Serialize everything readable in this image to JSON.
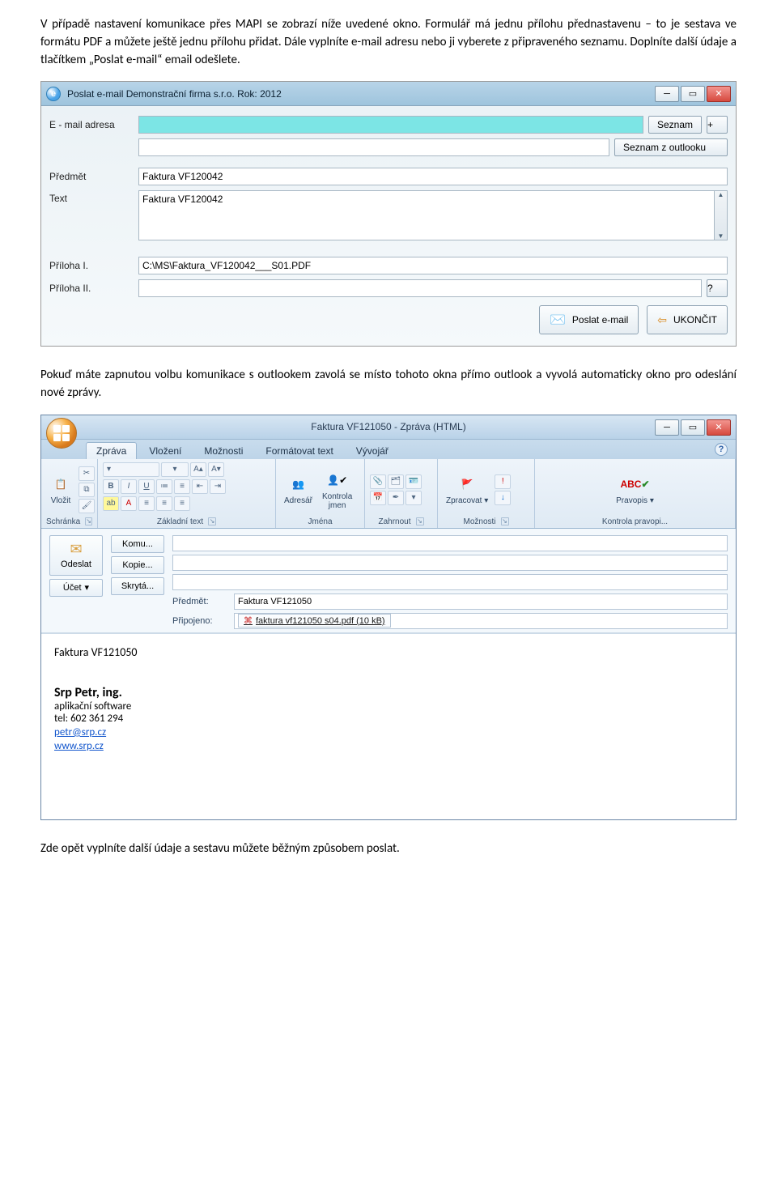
{
  "para1": "V případě nastavení komunikace přes MAPI se zobrazí níže uvedené okno. Formulář má jednu přílohu přednastavenu – to je sestava ve formátu PDF a můžete ještě jednu přílohu přidat. Dále vyplníte e-mail adresu nebo ji vyberete z připraveného seznamu. Doplníte další údaje a tlačítkem „Poslat e-mail“ email odešlete.",
  "win1": {
    "title": "Poslat e-mail   Demonstrační firma s.r.o.  Rok: 2012",
    "labels": {
      "email": "E - mail adresa",
      "subject": "Předmět",
      "text": "Text",
      "att1": "Příloha I.",
      "att2": "Příloha II."
    },
    "buttons": {
      "list": "Seznam",
      "plus": "+",
      "outlookList": "Seznam z outlooku",
      "help": "?",
      "send": "Poslat e-mail",
      "close": "UKONČIT"
    },
    "values": {
      "subject": "Faktura VF120042",
      "text": "Faktura VF120042",
      "att1": "C:\\MS\\Faktura_VF120042___S01.PDF"
    }
  },
  "para2": "Pokuď máte zapnutou volbu komunikace s outlookem zavolá se místo tohoto okna přímo outlook a vyvolá automaticky okno pro odeslání nové zprávy.",
  "win2": {
    "title": "Faktura VF121050   -  Zpráva (HTML)",
    "tabs": [
      "Zpráva",
      "Vložení",
      "Možnosti",
      "Formátovat text",
      "Vývojář"
    ],
    "ribbon": {
      "g1": {
        "btn": "Vložit",
        "cap": "Schránka"
      },
      "g2": {
        "cap": "Základní text"
      },
      "g3": {
        "btn1": "Adresář",
        "btn2": "Kontrola\njmen",
        "cap": "Jména"
      },
      "g4": {
        "cap": "Zahrnout"
      },
      "g5": {
        "btn": "Zpracovat",
        "cap": "Možnosti"
      },
      "g6": {
        "btn": "Pravopis",
        "cap": "Kontrola pravopi..."
      }
    },
    "header": {
      "send": "Odeslat",
      "account": "Účet",
      "to": "Komu...",
      "cc": "Kopie...",
      "bcc": "Skrytá...",
      "subjectLabel": "Předmět:",
      "subject": "Faktura VF121050",
      "attachLabel": "Připojeno:",
      "attachment": "faktura vf121050   s04.pdf (10 kB)"
    },
    "body": {
      "line1": "Faktura VF121050",
      "sigName": "Srp Petr, ing.",
      "sig1": "aplikační software",
      "sig2": "tel: 602 361 294",
      "sigMail": "petr@srp.cz",
      "sigWeb": "www.srp.cz"
    }
  },
  "para3": "Zde opět vyplníte další údaje a sestavu můžete běžným způsobem poslat."
}
